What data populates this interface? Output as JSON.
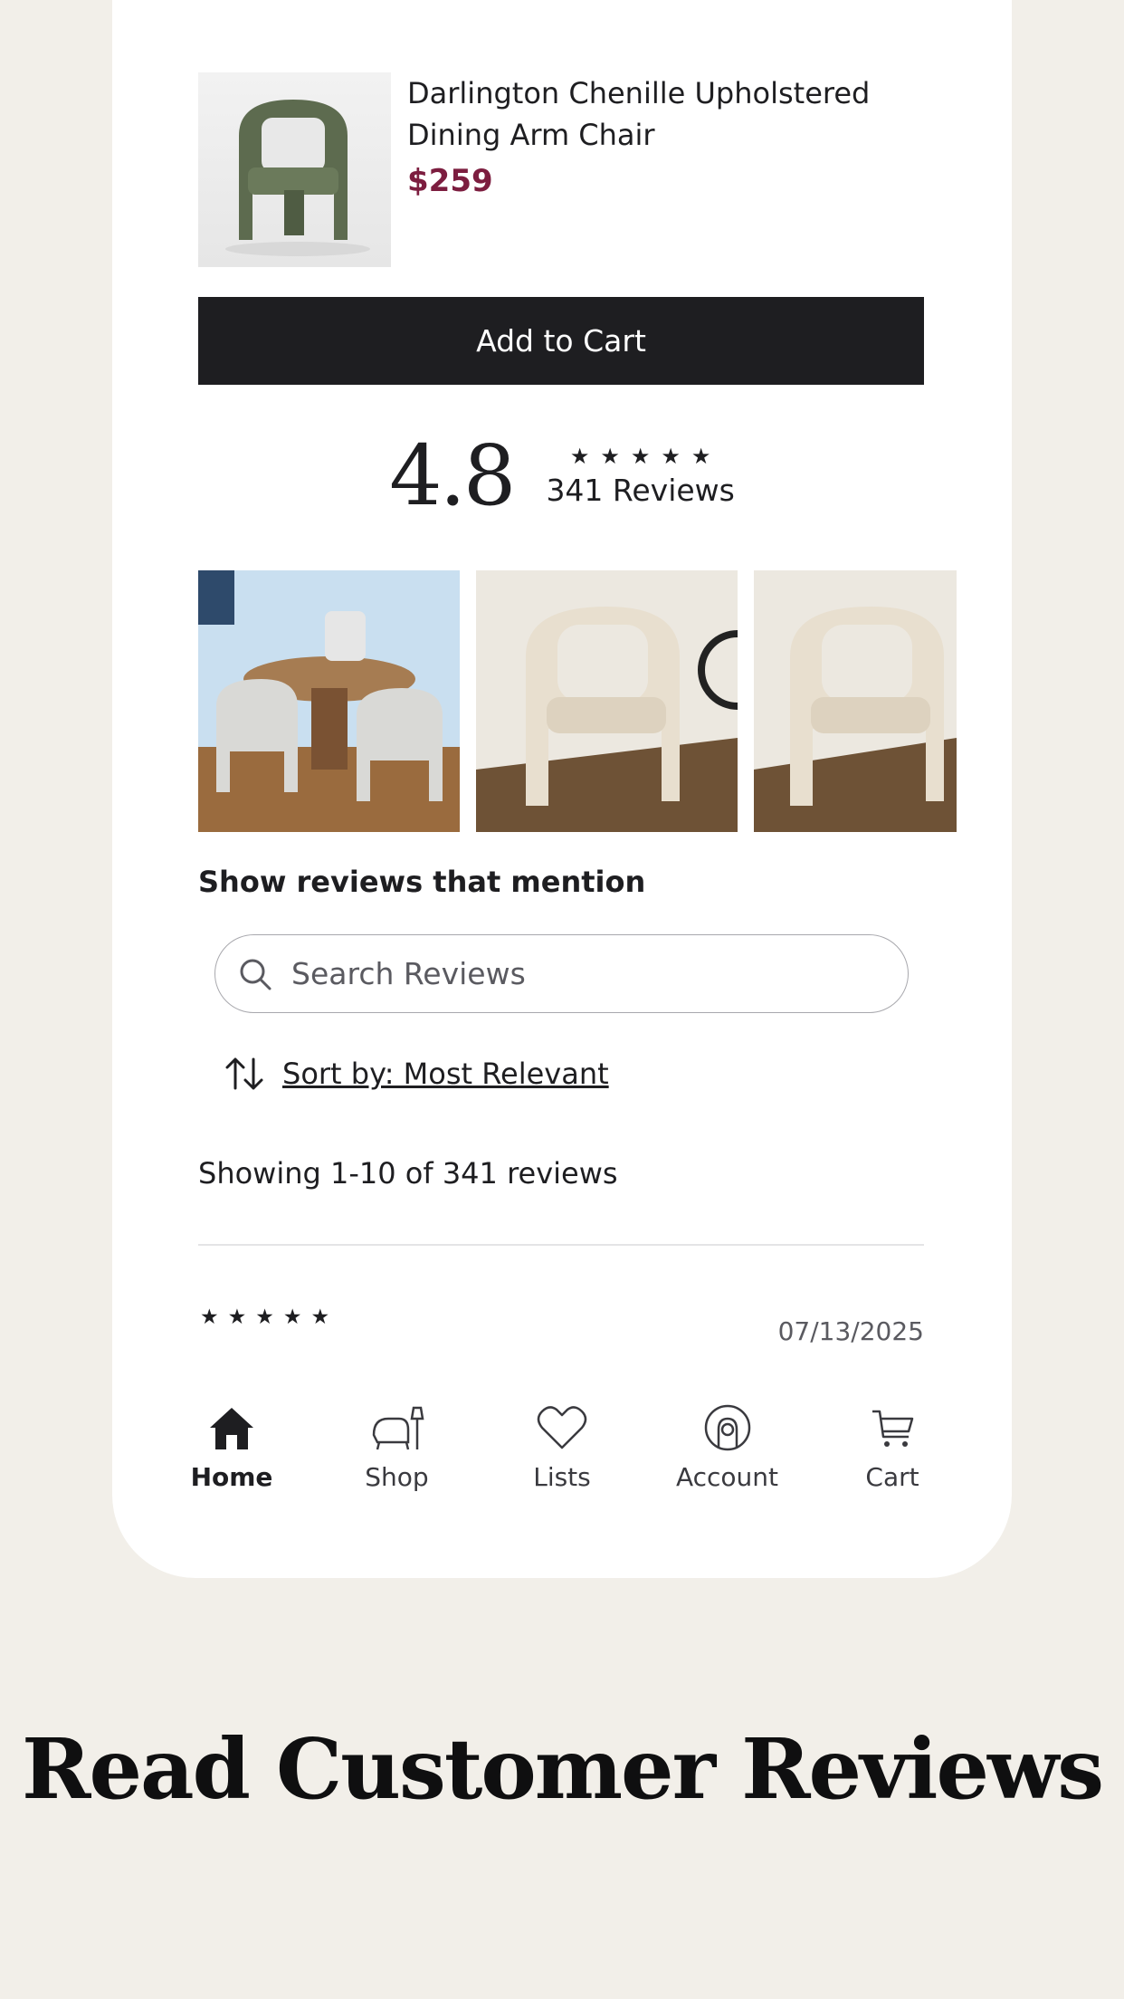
{
  "product": {
    "name": "Darlington Chenille Upholstered Dining Arm Chair",
    "price": "$259",
    "add_to_cart_label": "Add to Cart"
  },
  "rating": {
    "value": "4.8",
    "stars": 5,
    "review_count_label": "341 Reviews"
  },
  "reviews": {
    "mention_heading": "Show reviews that mention",
    "search_placeholder": "Search Reviews",
    "sort_label": "Sort by: Most Relevant",
    "showing_label": "Showing 1-10 of 341 reviews",
    "first_review": {
      "stars": 5,
      "date": "07/13/2025"
    }
  },
  "tabbar": {
    "items": [
      {
        "label": "Home",
        "icon": "home-icon",
        "active": true
      },
      {
        "label": "Shop",
        "icon": "chair-lamp-icon",
        "active": false
      },
      {
        "label": "Lists",
        "icon": "heart-icon",
        "active": false
      },
      {
        "label": "Account",
        "icon": "account-icon",
        "active": false
      },
      {
        "label": "Cart",
        "icon": "cart-icon",
        "active": false
      }
    ]
  },
  "headline": "Read Customer Reviews",
  "colors": {
    "background": "#f2efe9",
    "price": "#7c1d3f",
    "button": "#1e1e21"
  }
}
